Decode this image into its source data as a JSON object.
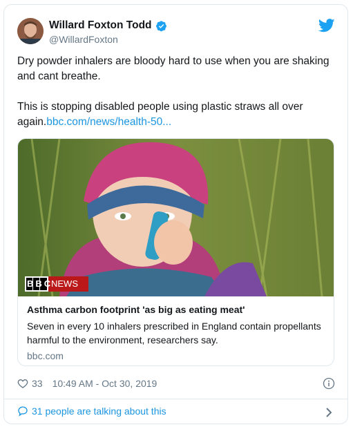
{
  "tweet": {
    "display_name": "Willard Foxton Todd",
    "handle": "@WillardFoxton",
    "text_line1": "Dry powder inhalers are bloody hard to use when you are shaking and cant breathe.",
    "text_line2": "This is stopping disabled people using plastic straws all over again.",
    "link_text": "bbc.com/news/health-50...",
    "likes": "33",
    "timestamp": "10:49 AM - Oct 30, 2019",
    "talking": "31 people are talking about this"
  },
  "card": {
    "badge_bbc": "BBC",
    "badge_news": "NEWS",
    "title": "Asthma carbon footprint 'as big as eating meat'",
    "description": "Seven in every 10 inhalers prescribed in England contain propellants harmful to the environment, researchers say.",
    "domain": "bbc.com"
  },
  "colors": {
    "accent": "#1da1f2",
    "link": "#1b95e0",
    "muted": "#657786",
    "border": "#e1e8ed",
    "bbc_red": "#bb1919"
  },
  "icons": [
    "avatar",
    "verified-icon",
    "twitter-bird-icon",
    "heart-icon",
    "info-icon",
    "speech-bubble-icon",
    "chevron-right-icon"
  ]
}
